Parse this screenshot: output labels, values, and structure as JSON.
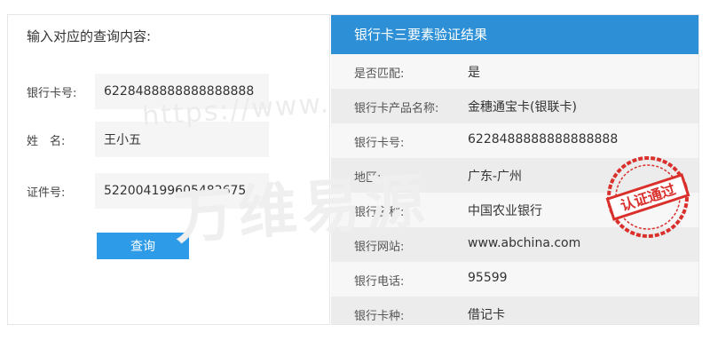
{
  "left_panel": {
    "title": "输入对应的查询内容:",
    "fields": [
      {
        "label": "银行卡号:",
        "value": "6228488888888888888"
      },
      {
        "label": "姓　名:",
        "value": "王小五"
      },
      {
        "label": "证件号:",
        "value": "522004199605482675"
      }
    ],
    "query_button_label": "查询"
  },
  "result_panel": {
    "title": "银行卡三要素验证结果",
    "rows": [
      {
        "label": "是否匹配:",
        "value": "是"
      },
      {
        "label": "银行卡产品名称:",
        "value": "金穗通宝卡(银联卡)"
      },
      {
        "label": "银行卡号:",
        "value": "6228488888888888888"
      },
      {
        "label": "地区:",
        "value": "广东-广州"
      },
      {
        "label": "银行名称:",
        "value": "中国农业银行"
      },
      {
        "label": "银行网站:",
        "value": "www.abchina.com"
      },
      {
        "label": "银行电话:",
        "value": "95599"
      },
      {
        "label": "银行卡种:",
        "value": "借记卡"
      }
    ]
  },
  "watermark": {
    "url_text": "https://www.s",
    "brand_text": "万维易源"
  },
  "stamp": {
    "text": "认证通过",
    "color": "#d9302c"
  },
  "colors": {
    "header_blue": "#2d90d6",
    "button_blue": "#2d9be8"
  }
}
